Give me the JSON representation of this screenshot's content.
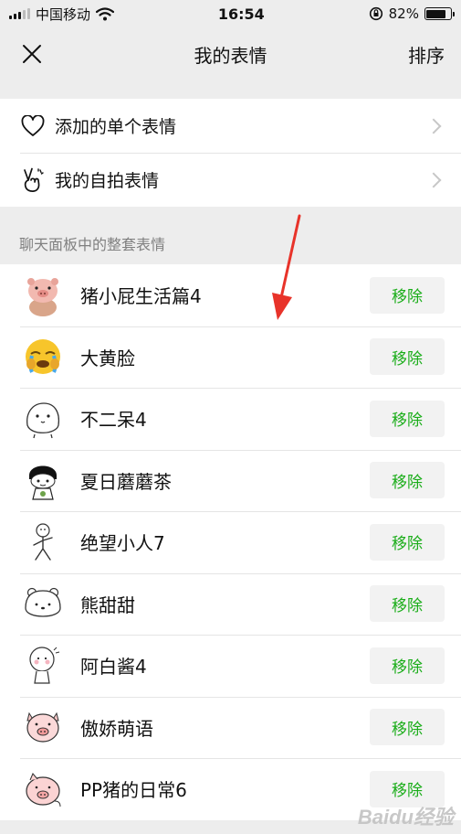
{
  "status_bar": {
    "carrier": "中国移动",
    "time": "16:54",
    "battery_percent": "82%",
    "battery_level": 0.82
  },
  "nav": {
    "close_icon": "close-icon",
    "title": "我的表情",
    "sort_label": "排序"
  },
  "top_menu": [
    {
      "label": "添加的单个表情",
      "icon": "heart-icon"
    },
    {
      "label": "我的自拍表情",
      "icon": "peace-hand-icon"
    }
  ],
  "section_title": "聊天面板中的整套表情",
  "packs": [
    {
      "name": "猪小屁生活篇4",
      "remove_label": "移除",
      "thumb": "pig-character"
    },
    {
      "name": "大黄脸",
      "remove_label": "移除",
      "thumb": "crying-yellow-face"
    },
    {
      "name": "不二呆4",
      "remove_label": "移除",
      "thumb": "white-blob"
    },
    {
      "name": "夏日蘑蘑茶",
      "remove_label": "移除",
      "thumb": "mushroom-head"
    },
    {
      "name": "绝望小人7",
      "remove_label": "移除",
      "thumb": "stick-figure"
    },
    {
      "name": "熊甜甜",
      "remove_label": "移除",
      "thumb": "white-bear"
    },
    {
      "name": "阿白酱4",
      "remove_label": "移除",
      "thumb": "white-character"
    },
    {
      "name": "傲娇萌语",
      "remove_label": "移除",
      "thumb": "pink-pig"
    },
    {
      "name": "PP猪的日常6",
      "remove_label": "移除",
      "thumb": "pink-pig-2"
    }
  ],
  "colors": {
    "background": "#ededed",
    "accent_green": "#1aad19",
    "arrow_red": "#e8332a"
  },
  "watermark": "Baidu经验"
}
